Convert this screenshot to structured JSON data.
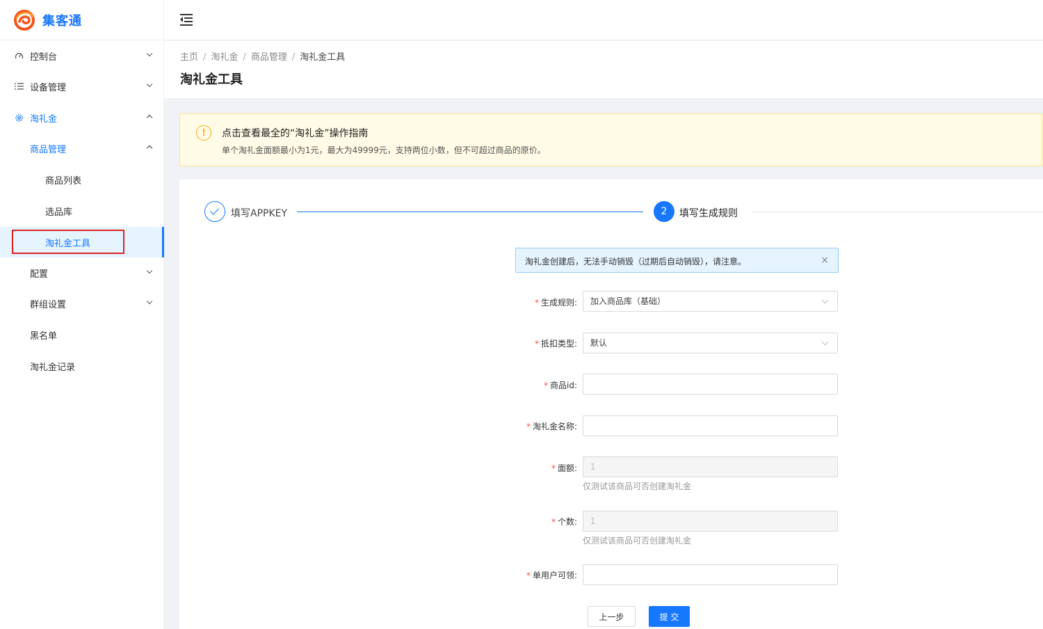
{
  "app": {
    "name": "集客通"
  },
  "sidebar": {
    "items": [
      {
        "label": "控制台",
        "icon": "dashboard-icon"
      },
      {
        "label": "设备管理",
        "icon": "list-icon"
      },
      {
        "label": "淘礼金",
        "icon": "gear-icon"
      },
      {
        "label": "商品管理"
      },
      {
        "label": "商品列表"
      },
      {
        "label": "选品库"
      },
      {
        "label": "淘礼金工具"
      },
      {
        "label": "配置"
      },
      {
        "label": "群组设置"
      },
      {
        "label": "黑名单"
      },
      {
        "label": "淘礼金记录"
      }
    ]
  },
  "breadcrumb": {
    "items": [
      "主页",
      "淘礼金",
      "商品管理",
      "淘礼金工具"
    ]
  },
  "page": {
    "title": "淘礼金工具"
  },
  "warning": {
    "title": "点击查看最全的“淘礼金”操作指南",
    "description": "单个淘礼金面额最小为1元，最大为49999元，支持两位小数，但不可超过商品的原价。"
  },
  "steps": [
    {
      "label": "填写APPKEY",
      "status": "finished"
    },
    {
      "number": "2",
      "label": "填写生成规则",
      "status": "active"
    }
  ],
  "info_alert": {
    "text": "淘礼金创建后，无法手动销毁（过期后自动销毁），请注意。",
    "close": "×"
  },
  "form": {
    "rule": {
      "label": "生成规则",
      "value": "加入商品库（基础）"
    },
    "deduct_type": {
      "label": "抵扣类型",
      "value": "默认"
    },
    "item_id": {
      "label": "商品id",
      "value": ""
    },
    "gift_name": {
      "label": "淘礼金名称",
      "value": ""
    },
    "amount": {
      "label": "面额",
      "value": "1",
      "help": "仅测试该商品可否创建淘礼金"
    },
    "count": {
      "label": "个数",
      "value": "1",
      "help": "仅测试该商品可否创建淘礼金"
    },
    "per_user": {
      "label": "单用户可领",
      "value": ""
    }
  },
  "buttons": {
    "prev": "上一步",
    "submit": "提 交"
  },
  "colors": {
    "primary": "#1677ff",
    "warning": "#faad14",
    "required": "#ff4d4f",
    "highlight": "#e02020"
  }
}
